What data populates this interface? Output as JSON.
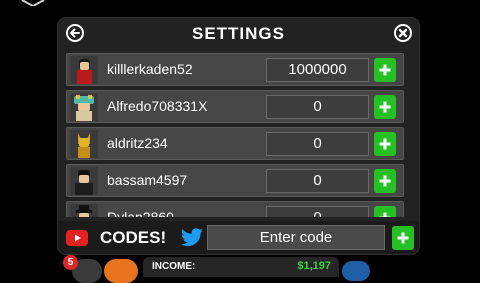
{
  "settings": {
    "title": "SETTINGS",
    "players": [
      {
        "username": "killlerkaden52",
        "value": "1000000",
        "avatar": "black-hair-avatar"
      },
      {
        "username": "Alfredo708331X",
        "value": "0",
        "avatar": "teal-headdress-avatar"
      },
      {
        "username": "aldritz234",
        "value": "0",
        "avatar": "golden-dog-avatar"
      },
      {
        "username": "bassam4597",
        "value": "0",
        "avatar": "black-hair-avatar"
      },
      {
        "username": "Dylan2860",
        "value": "0",
        "avatar": "black-hat-avatar"
      }
    ]
  },
  "codes": {
    "label": "CODES!",
    "placeholder": "Enter code"
  },
  "hud": {
    "notification_count": "5",
    "income_label": "INCOME:",
    "income_value": "$1,197"
  },
  "colors": {
    "panel": "#222222",
    "row": "#464646",
    "plus_button": "#24c024",
    "income_value": "#3cd23c",
    "youtube": "#e52222",
    "twitter": "#1d9bf0"
  }
}
